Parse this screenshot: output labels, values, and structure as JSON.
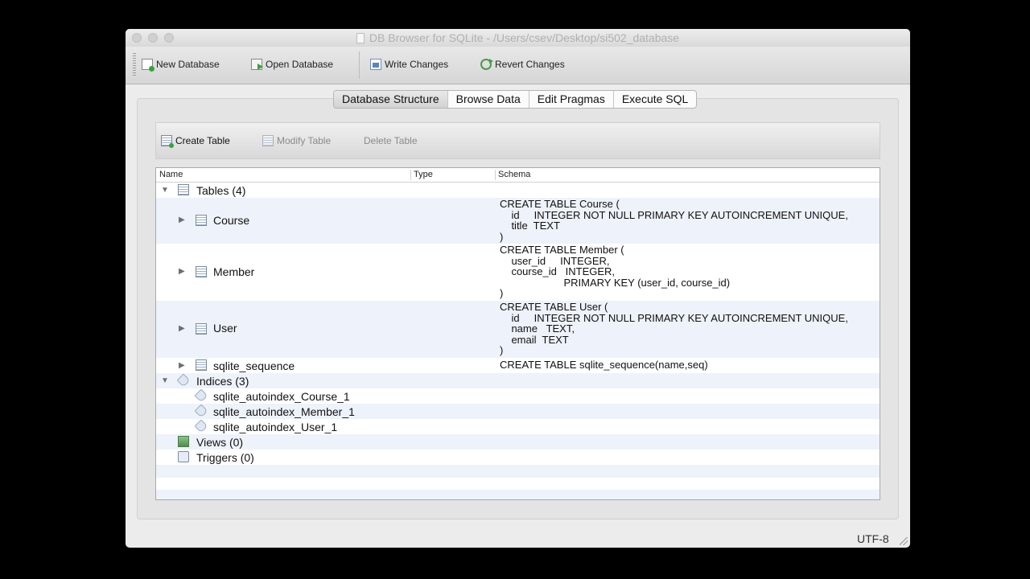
{
  "window": {
    "title": "DB Browser for SQLite - /Users/csev/Desktop/si502_database"
  },
  "toolbar": {
    "new_database": "New Database",
    "open_database": "Open Database",
    "write_changes": "Write Changes",
    "revert_changes": "Revert Changes"
  },
  "tabs": [
    {
      "label": "Database Structure",
      "active": true
    },
    {
      "label": "Browse Data",
      "active": false
    },
    {
      "label": "Edit Pragmas",
      "active": false
    },
    {
      "label": "Execute SQL",
      "active": false
    }
  ],
  "subtoolbar": {
    "create_table": "Create Table",
    "modify_table": "Modify Table",
    "delete_table": "Delete Table"
  },
  "tree": {
    "columns": [
      "Name",
      "Type",
      "Schema"
    ],
    "tables_group": "Tables (4)",
    "tables": [
      {
        "name": "Course",
        "schema": "CREATE TABLE Course (\n    id     INTEGER NOT NULL PRIMARY KEY AUTOINCREMENT UNIQUE,\n    title  TEXT\n)"
      },
      {
        "name": "Member",
        "schema": "CREATE TABLE Member (\n    user_id     INTEGER,\n    course_id   INTEGER,\n                      PRIMARY KEY (user_id, course_id)\n)"
      },
      {
        "name": "User",
        "schema": "CREATE TABLE User (\n    id     INTEGER NOT NULL PRIMARY KEY AUTOINCREMENT UNIQUE,\n    name   TEXT,\n    email  TEXT\n)"
      },
      {
        "name": "sqlite_sequence",
        "schema": "CREATE TABLE sqlite_sequence(name,seq)"
      }
    ],
    "indices_group": "Indices (3)",
    "indices": [
      "sqlite_autoindex_Course_1",
      "sqlite_autoindex_Member_1",
      "sqlite_autoindex_User_1"
    ],
    "views_group": "Views (0)",
    "triggers_group": "Triggers (0)"
  },
  "status": {
    "encoding": "UTF-8"
  }
}
